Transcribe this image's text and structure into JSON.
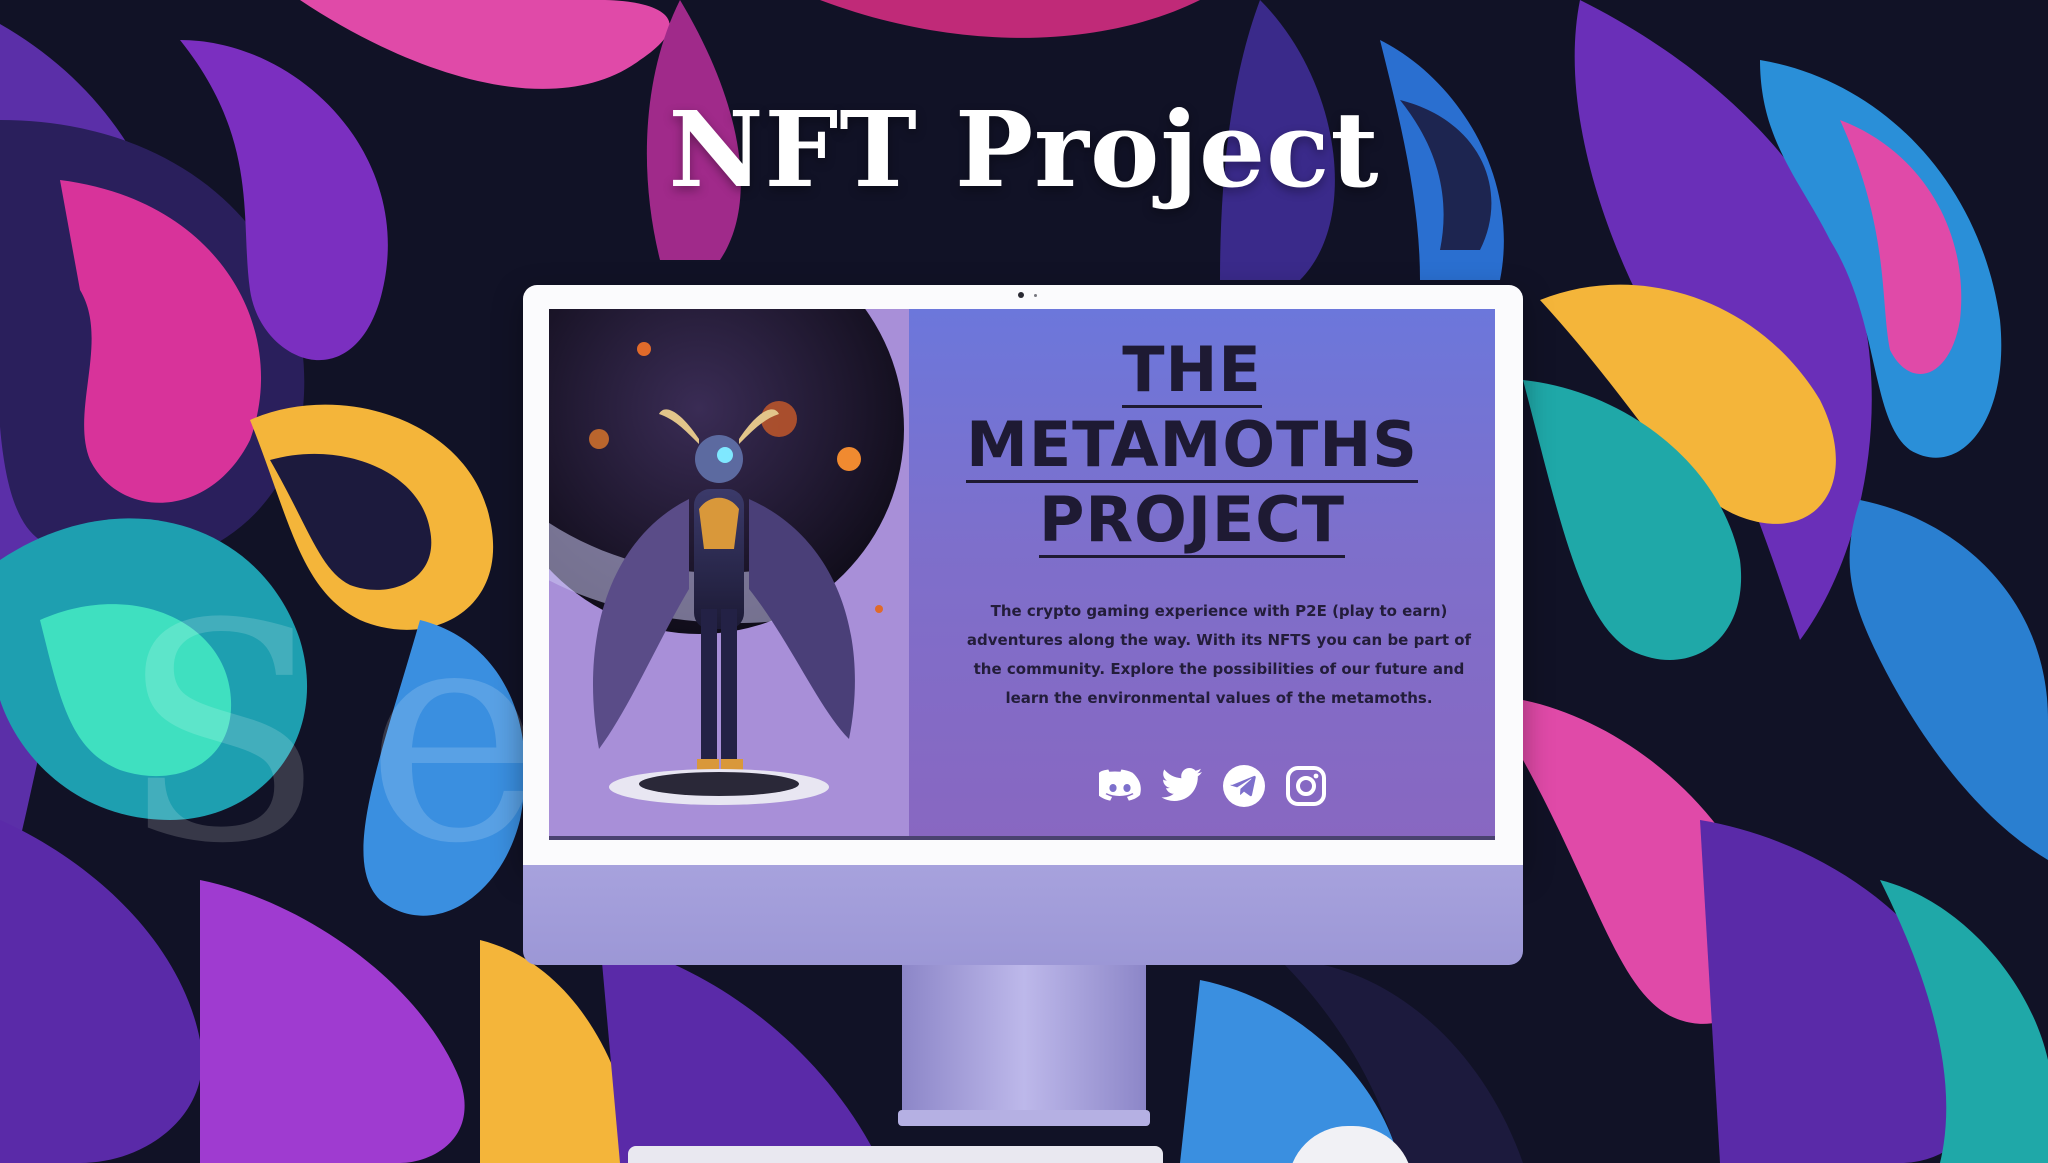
{
  "page": {
    "title": "NFT Project",
    "watermark": "Sevice"
  },
  "screen": {
    "heading_lines": [
      "THE",
      "METAMOTHS",
      "PROJECT"
    ],
    "description": "The crypto gaming experience with P2E (play to earn) adventures along the way. With its NFTS you can be part of the community. Explore the possibilities of our future and learn the environmental values of the metamoths.",
    "socials": [
      {
        "icon": "discord-icon"
      },
      {
        "icon": "twitter-icon"
      },
      {
        "icon": "telegram-icon"
      },
      {
        "icon": "instagram-icon"
      }
    ]
  },
  "colors": {
    "screen_gradient_top": "#6c77db",
    "screen_gradient_bottom": "#8867c1",
    "imac_body": "#fbfbfd",
    "imac_chin": "#a7a2dd",
    "heading": "#1e1a33"
  }
}
